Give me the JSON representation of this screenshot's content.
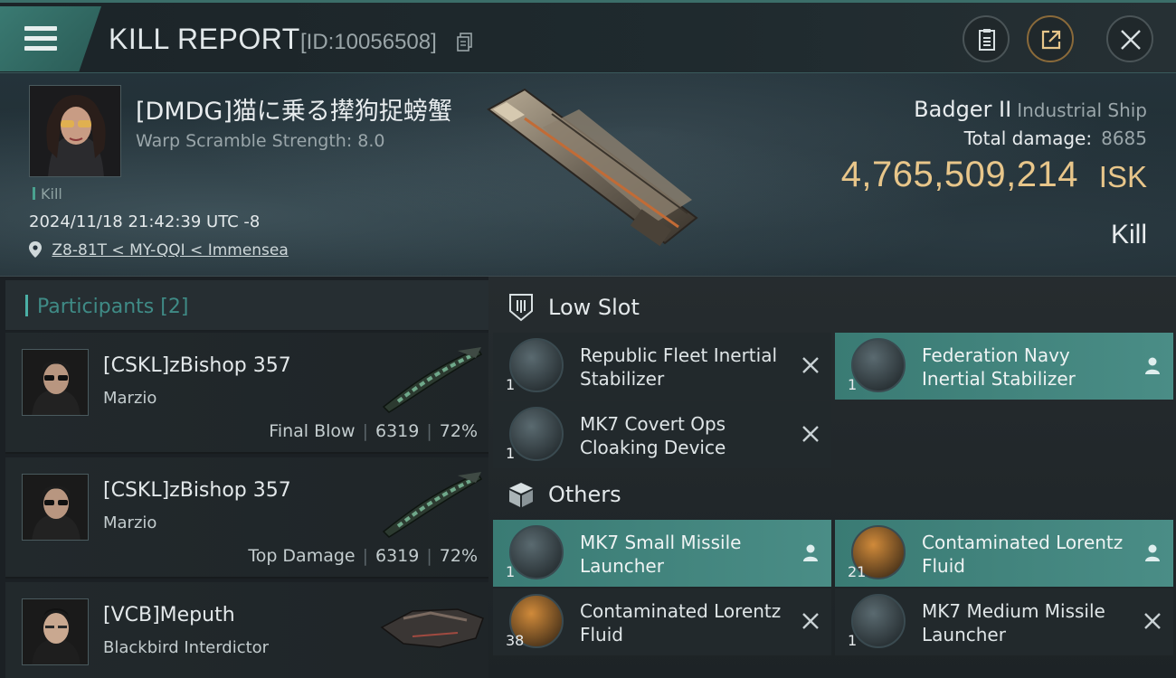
{
  "header": {
    "title": "KILL REPORT",
    "report_id": "[ID:10056508]"
  },
  "victim": {
    "name": "[DMDG]猫に乗る撵狗捉螃蟹",
    "warp_scramble": "Warp Scramble Strength: 8.0",
    "kill_tag": "Kill",
    "timestamp": "2024/11/18 21:42:39 UTC -8",
    "location": "Z8-81T < MY-QQI < Immensea",
    "ship_name": "Badger II",
    "ship_class": "Industrial Ship",
    "total_damage_label": "Total damage:",
    "total_damage": "8685",
    "isk_value": "4,765,509,214",
    "isk_unit": "ISK",
    "result": "Kill"
  },
  "participants": {
    "title": "Participants",
    "count": "[2]",
    "items": [
      {
        "name": "[CSKL]zBishop 357",
        "ship": "Marzio",
        "role": "Final Blow",
        "damage": "6319",
        "percent": "72%"
      },
      {
        "name": "[CSKL]zBishop 357",
        "ship": "Marzio",
        "role": "Top Damage",
        "damage": "6319",
        "percent": "72%"
      },
      {
        "name": "[VCB]Meputh",
        "ship": "Blackbird Interdictor"
      }
    ]
  },
  "low_slot": {
    "title": "Low Slot",
    "items": [
      {
        "name": "Republic Fleet Inertial Stabilizer",
        "qty": "1",
        "status": "destroyed"
      },
      {
        "name": "Federation Navy Inertial Stabilizer",
        "qty": "1",
        "status": "dropped"
      },
      {
        "name": "MK7 Covert Ops Cloaking Device",
        "qty": "1",
        "status": "destroyed"
      }
    ]
  },
  "others": {
    "title": "Others",
    "items": [
      {
        "name": "MK7 Small Missile Launcher",
        "qty": "1",
        "status": "dropped"
      },
      {
        "name": "Contaminated Lorentz Fluid",
        "qty": "21",
        "status": "dropped"
      },
      {
        "name": "Contaminated Lorentz Fluid",
        "qty": "38",
        "status": "destroyed"
      },
      {
        "name": "MK7 Medium Missile Launcher",
        "qty": "1",
        "status": "destroyed"
      }
    ]
  },
  "colors": {
    "accent": "#4a8d86",
    "isk": "#e8c68a",
    "participants_title": "#3f8b86"
  },
  "icons": {
    "menu": "hamburger-icon",
    "copy": "copy-icon",
    "clipboard": "clipboard-icon",
    "share": "share-icon",
    "close": "close-icon",
    "location": "location-pin-icon",
    "low_slot": "low-slot-icon",
    "others": "cube-icon",
    "destroyed": "x-icon",
    "dropped": "person-icon"
  }
}
